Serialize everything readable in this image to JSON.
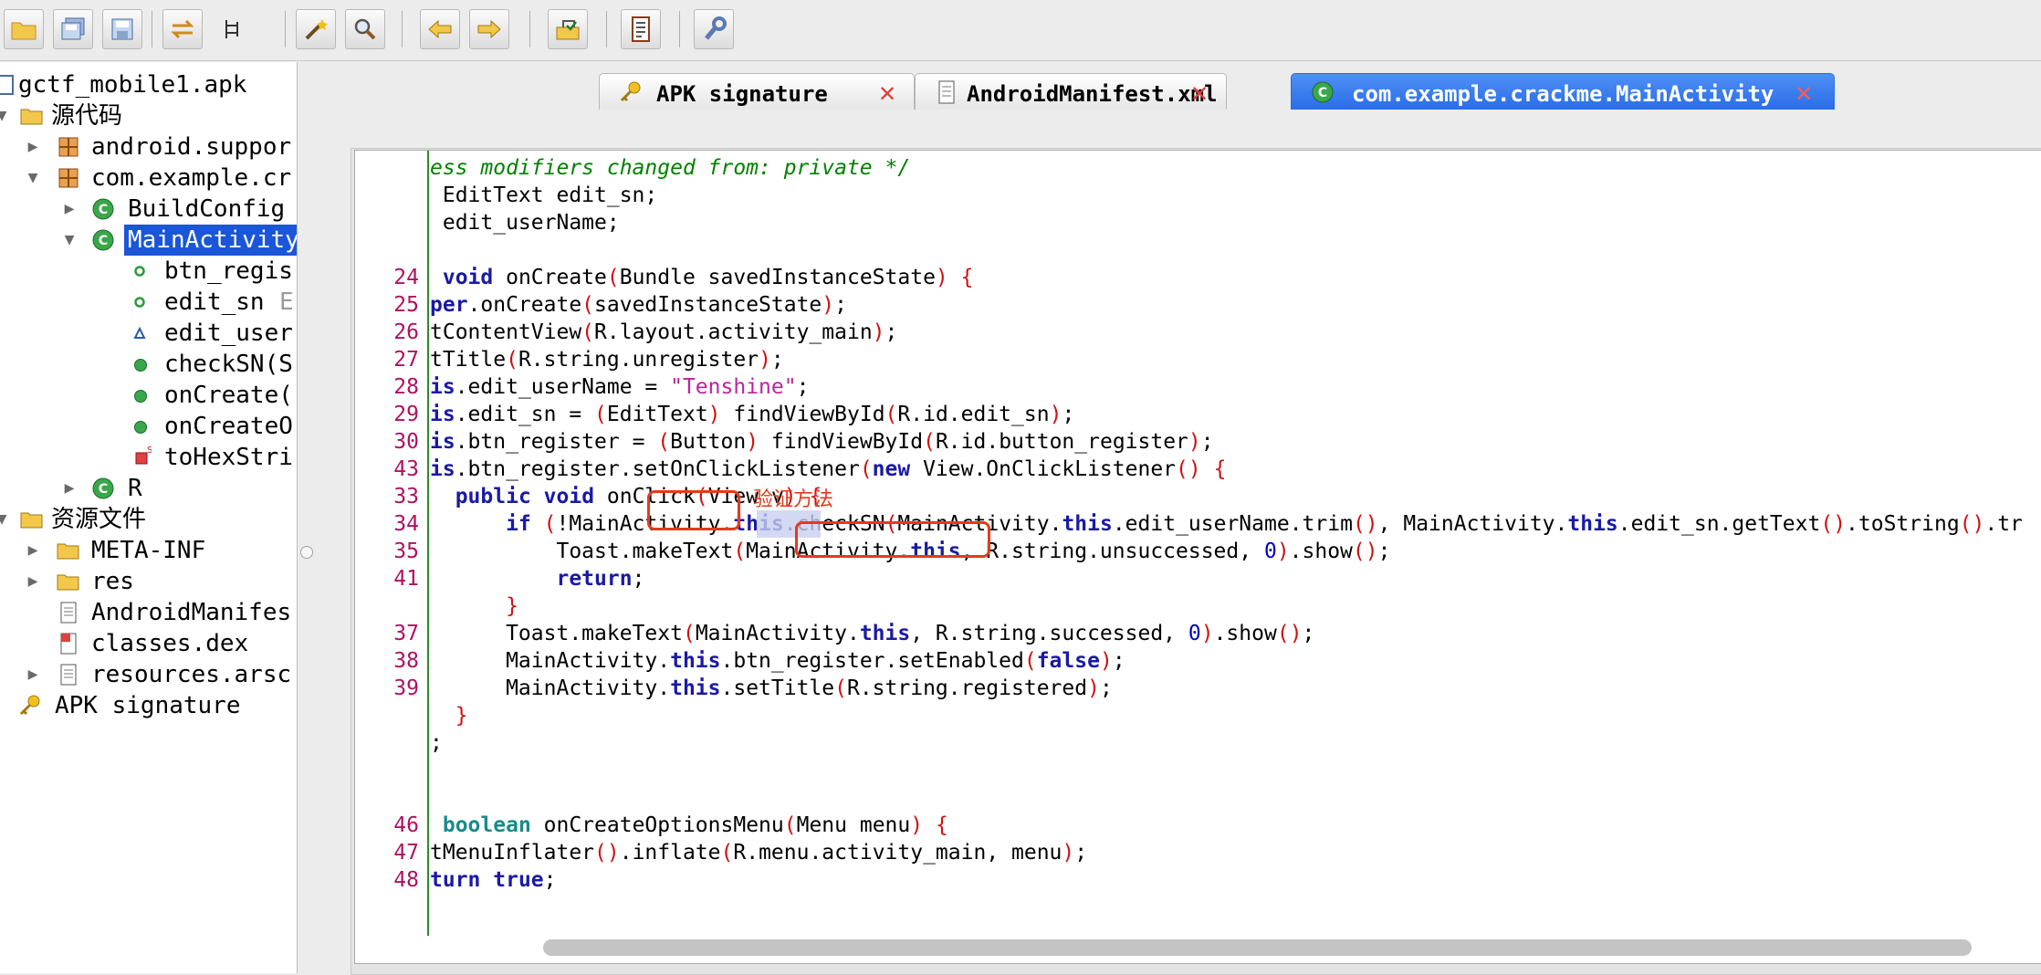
{
  "toolbar": {
    "buttons": [
      "open-folder-icon",
      "save-all-icon",
      "save-icon",
      "sync-icon",
      "tree-icon",
      "wand-icon",
      "search-icon",
      "back-arrow-icon",
      "forward-arrow-icon",
      "export-icon",
      "log-icon",
      "wrench-icon"
    ]
  },
  "tree": {
    "root": "gctf_mobile1.apk",
    "source_folder": "源代码",
    "pkg_android": "android.suppor",
    "pkg_example": "com.example.cr",
    "class_buildconfig": "BuildConfig",
    "class_mainactivity": "MainActivity",
    "field_btn_register": "btn_regis",
    "field_edit_sn": "edit_sn",
    "field_edit_sn_type": "E",
    "field_edit_username": "edit_user",
    "method_checksn": "checkSN(S",
    "method_oncreate": "onCreate(",
    "method_oncreateoptions": "onCreateO",
    "method_tohexstring": "toHexStri",
    "class_r": "R",
    "resource_folder": "资源文件",
    "meta_inf": "META-INF",
    "res": "res",
    "manifest": "AndroidManifes",
    "classes_dex": "classes.dex",
    "resources_arsc": "resources.arsc",
    "apk_signature": "APK signature"
  },
  "tabs": [
    {
      "label": "APK signature",
      "active": false
    },
    {
      "label": "AndroidManifest.xml",
      "active": false
    },
    {
      "label": "com.example.crackme.MainActivity",
      "active": true
    }
  ],
  "annotation": "验证方法",
  "code": {
    "line_numbers": [
      "",
      "",
      "",
      "",
      "24",
      "25",
      "26",
      "27",
      "28",
      "29",
      "30",
      "43",
      "33",
      "34",
      "35",
      "41",
      "",
      "37",
      "38",
      "39",
      "",
      "",
      "",
      "",
      "46",
      "47",
      "48"
    ],
    "lines": [
      "ess modifiers changed from: private */",
      " EditText edit_sn;",
      " edit_userName;",
      "",
      " void onCreate(Bundle savedInstanceState) {",
      "per.onCreate(savedInstanceState);",
      "tContentView(R.layout.activity_main);",
      "tTitle(R.string.unregister);",
      "is.edit_userName = \"Tenshine\";",
      "is.edit_sn = (EditText) findViewById(R.id.edit_sn);",
      "is.btn_register = (Button) findViewById(R.id.button_register);",
      "is.btn_register.setOnClickListener(new View.OnClickListener() {",
      "  public void onClick(View v) {",
      "      if (!MainActivity.this.checkSN(MainActivity.this.edit_userName.trim(), MainActivity.this.edit_sn.getText().toString().tr",
      "          Toast.makeText(MainActivity.this, R.string.unsuccessed, 0).show();",
      "          return;",
      "      }",
      "      Toast.makeText(MainActivity.this, R.string.successed, 0).show();",
      "      MainActivity.this.btn_register.setEnabled(false);",
      "      MainActivity.this.setTitle(R.string.registered);",
      "  }",
      ";",
      "",
      "",
      " boolean onCreateOptionsMenu(Menu menu) {",
      "tMenuInflater().inflate(R.menu.activity_main, menu);",
      "turn true;"
    ]
  },
  "colors": {
    "selection": "#1a56d8",
    "active_tab": "#2a6de8",
    "annotation_red": "#e53a1a",
    "line_number": "#b01060",
    "keyword": "#1a1aa6",
    "string": "#c020a0",
    "comment": "#008000"
  }
}
